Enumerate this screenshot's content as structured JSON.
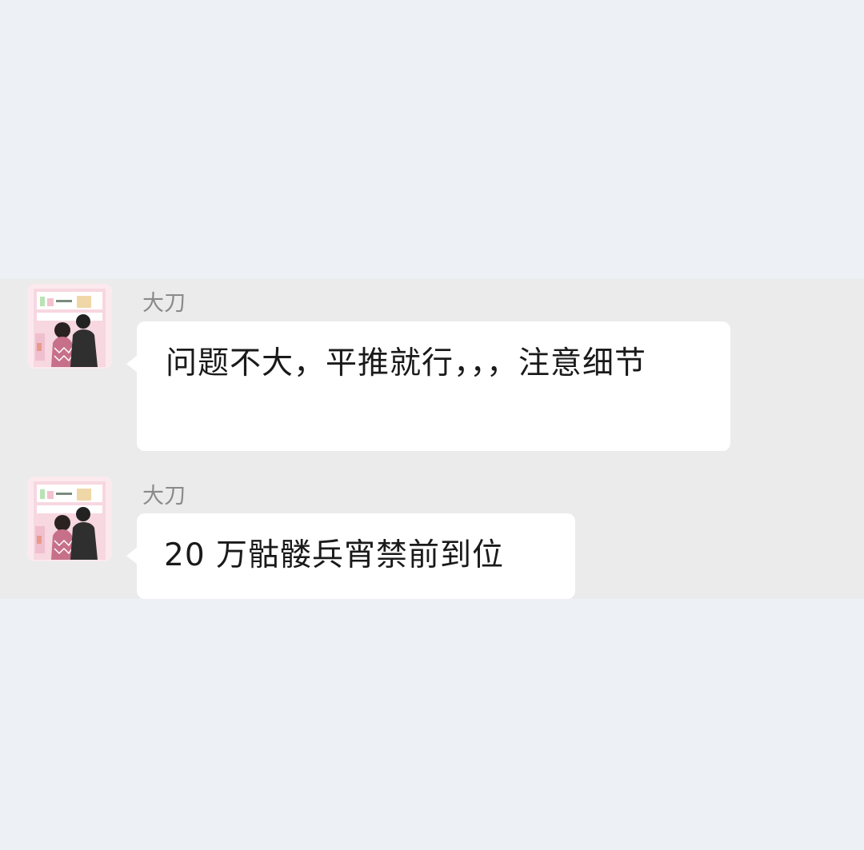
{
  "messages": [
    {
      "sender": "大刀",
      "text": "问题不大，平推就行，，，注意细节"
    },
    {
      "sender": "大刀",
      "text": "20 万骷髅兵宵禁前到位"
    }
  ],
  "colors": {
    "page_background": "#edf1f5",
    "chat_background": "#ebebeb",
    "bubble": "#ffffff",
    "sender_text": "#8a8a8a",
    "message_text": "#1a1a1a"
  },
  "icons": {
    "avatar": "couple-at-shelf-avatar-icon"
  }
}
